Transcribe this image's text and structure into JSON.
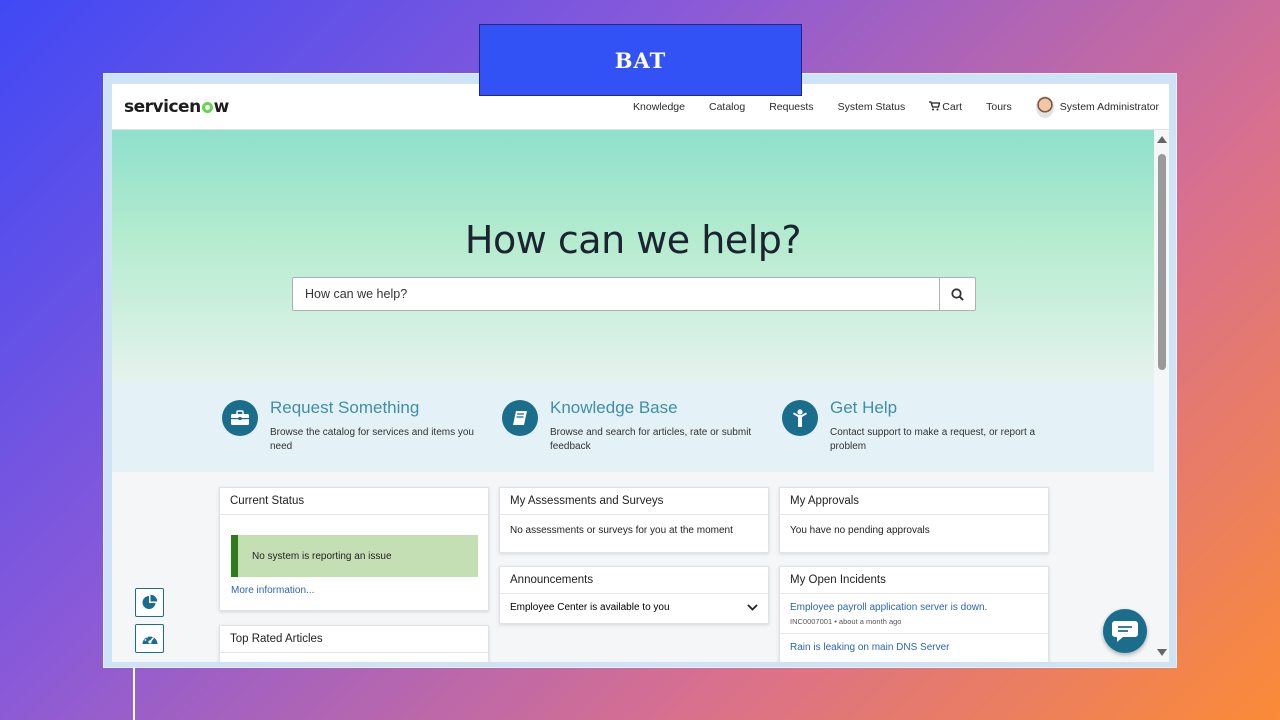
{
  "banner": {
    "label": "BAT"
  },
  "header": {
    "logo": "servicenow",
    "nav": {
      "knowledge": "Knowledge",
      "catalog": "Catalog",
      "requests": "Requests",
      "system_status": "System Status",
      "cart": "Cart",
      "tours": "Tours",
      "user": "System Administrator"
    }
  },
  "hero": {
    "title": "How can we help?",
    "search_placeholder": "How can we help?"
  },
  "quick_links": [
    {
      "title": "Request Something",
      "desc": "Browse the catalog for services and items you need",
      "icon": "briefcase-icon"
    },
    {
      "title": "Knowledge Base",
      "desc": "Browse and search for articles, rate or submit feedback",
      "icon": "book-icon"
    },
    {
      "title": "Get Help",
      "desc": "Contact support to make a request, or report a problem",
      "icon": "person-help-icon"
    }
  ],
  "cards": {
    "current_status": {
      "title": "Current Status",
      "message": "No system is reporting an issue",
      "more": "More information..."
    },
    "top_rated": {
      "title": "Top Rated Articles"
    },
    "assessments": {
      "title": "My Assessments and Surveys",
      "message": "No assessments or surveys for you at the moment"
    },
    "announcements": {
      "title": "Announcements",
      "item": "Employee Center is available to you"
    },
    "approvals": {
      "title": "My Approvals",
      "message": "You have no pending approvals"
    },
    "incidents": {
      "title": "My Open Incidents",
      "items": [
        {
          "title": "Employee payroll application server is down.",
          "meta": "INC0007001 • about a month ago"
        },
        {
          "title": "Rain is leaking on main DNS Server",
          "meta": ""
        }
      ]
    }
  },
  "colors": {
    "accent": "#1b6d8c",
    "link": "#2b66b7",
    "status_ok": "#c5dfb5",
    "banner": "#3352f5"
  }
}
